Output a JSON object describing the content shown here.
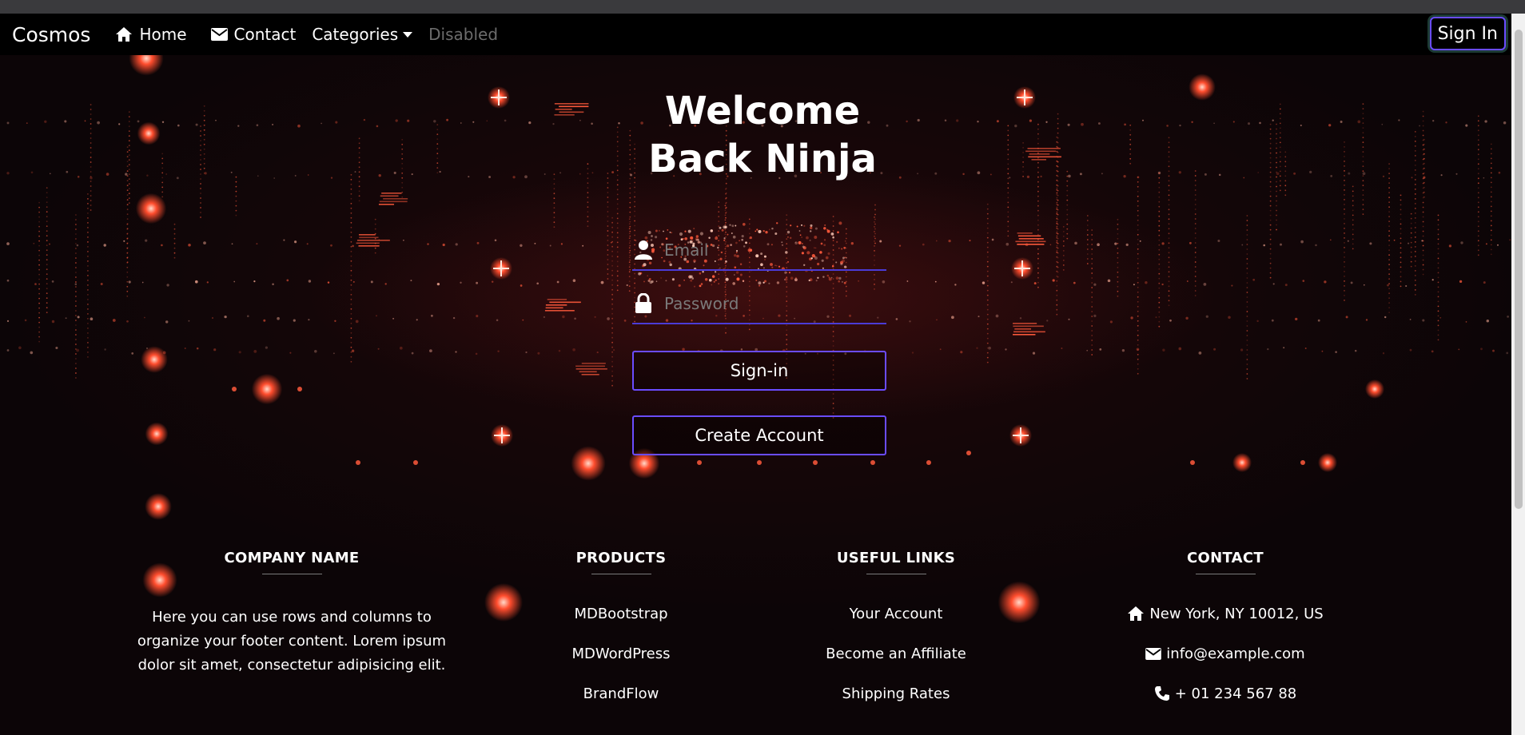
{
  "navbar": {
    "brand": "Cosmos",
    "links": [
      {
        "label": "Home",
        "icon": "home-icon"
      },
      {
        "label": "Contact",
        "icon": "envelope-icon"
      },
      {
        "label": "Categories",
        "icon": "chevron-down-icon"
      },
      {
        "label": "Disabled",
        "disabled": true
      }
    ],
    "signin_label": "Sign In"
  },
  "hero": {
    "title_line1": "Welcome",
    "title_line2": "Back Ninja"
  },
  "form": {
    "email_placeholder": "Email",
    "password_placeholder": "Password",
    "signin_button": "Sign-in",
    "create_account_button": "Create Account"
  },
  "footer": {
    "company": {
      "heading": "COMPANY NAME",
      "text": "Here you can use rows and columns to organize your footer content. Lorem ipsum dolor sit amet, consectetur adipisicing elit."
    },
    "products": {
      "heading": "PRODUCTS",
      "items": [
        "MDBootstrap",
        "MDWordPress",
        "BrandFlow"
      ]
    },
    "useful_links": {
      "heading": "USEFUL LINKS",
      "items": [
        "Your Account",
        "Become an Affiliate",
        "Shipping Rates"
      ]
    },
    "contact": {
      "heading": "CONTACT",
      "items": [
        {
          "icon": "home-icon",
          "text": "New York, NY 10012, US"
        },
        {
          "icon": "envelope-icon",
          "text": "info@example.com"
        },
        {
          "icon": "phone-icon",
          "text": "+ 01 234 567 88"
        }
      ]
    }
  },
  "colors": {
    "accent": "#6a4cff",
    "background": "#0c0507",
    "particle": "#ff5a3c"
  }
}
